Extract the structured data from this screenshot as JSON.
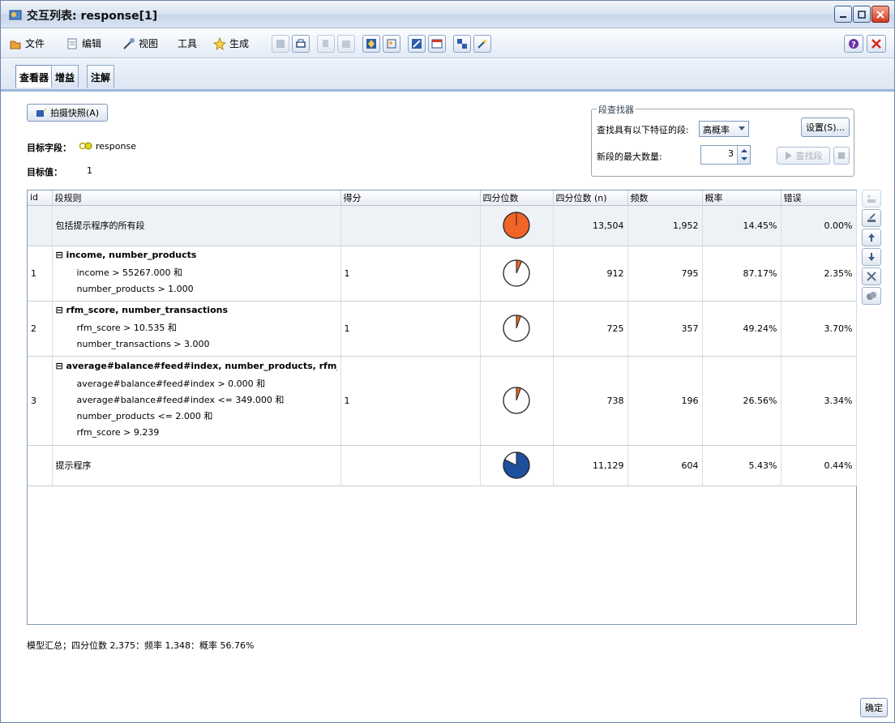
{
  "window": {
    "title": "交互列表: response[1]"
  },
  "menu": [
    {
      "label": "文件",
      "icon": "file-icon"
    },
    {
      "label": "编辑",
      "icon": "edit-icon"
    },
    {
      "label": "视图",
      "icon": "view-icon"
    },
    {
      "label": "工具",
      "icon": ""
    },
    {
      "label": "生成",
      "icon": "generate-icon"
    }
  ],
  "tabs": [
    {
      "label": "查看器",
      "active": true
    },
    {
      "label": "增益",
      "active": false
    },
    {
      "label": "注解",
      "active": false
    }
  ],
  "snapshot_button": "拍摄快照(A)",
  "target_field": {
    "label": "目标字段：",
    "value": "response"
  },
  "target_value": {
    "label": "目标值：",
    "value": "1"
  },
  "finder": {
    "legend": "段查找器",
    "search_label": "查找具有以下特征的段:",
    "search_value": "高概率",
    "settings_button": "设置(S)...",
    "max_label": "新段的最大数量:",
    "max_value": "3",
    "find_button": "查找段"
  },
  "table": {
    "headers": [
      "id",
      "段规则",
      "得分",
      "四分位数",
      "四分位数 (n)",
      "频数",
      "概率",
      "错误"
    ],
    "rows": [
      {
        "id": "",
        "title": "包括提示程序的所有段",
        "rule_lines": [],
        "score": "",
        "pie": 0.1445,
        "pie_color": "#f06428",
        "pie_full": true,
        "n": "13,504",
        "freq": "1,952",
        "prob": "14.45%",
        "err": "0.00%"
      },
      {
        "id": "1",
        "title": "income, number_products",
        "rule_lines": [
          "income > 55267.000 和",
          "number_products > 1.000"
        ],
        "score": "1",
        "pie": 0.0675,
        "pie_color": "#f06428",
        "pie_full": false,
        "n": "912",
        "freq": "795",
        "prob": "87.17%",
        "err": "2.35%"
      },
      {
        "id": "2",
        "title": "rfm_score, number_transactions",
        "rule_lines": [
          "rfm_score > 10.535 和",
          "number_transactions > 3.000"
        ],
        "score": "1",
        "pie": 0.0537,
        "pie_color": "#f06428",
        "pie_full": false,
        "n": "725",
        "freq": "357",
        "prob": "49.24%",
        "err": "3.70%"
      },
      {
        "id": "3",
        "title": "average#balance#feed#index, number_products, rfm_s",
        "rule_lines": [
          "average#balance#feed#index > 0.000 和",
          "average#balance#feed#index <= 349.000 和",
          "number_products <= 2.000 和",
          "rfm_score > 9.239"
        ],
        "score": "1",
        "pie": 0.0547,
        "pie_color": "#f06428",
        "pie_full": false,
        "n": "738",
        "freq": "196",
        "prob": "26.56%",
        "err": "3.34%"
      },
      {
        "id": "",
        "title": "提示程序",
        "rule_lines": [],
        "score": "",
        "pie": 0.8241,
        "pie_color": "#1f4f9c",
        "pie_full": false,
        "n": "11,129",
        "freq": "604",
        "prob": "5.43%",
        "err": "0.44%"
      }
    ]
  },
  "summary": "模型汇总；四分位数 2,375：频率 1,348：概率 56.76%",
  "ok_button": "确定",
  "colors": {
    "accent": "#1f4f9c",
    "highlight": "#f06428"
  }
}
